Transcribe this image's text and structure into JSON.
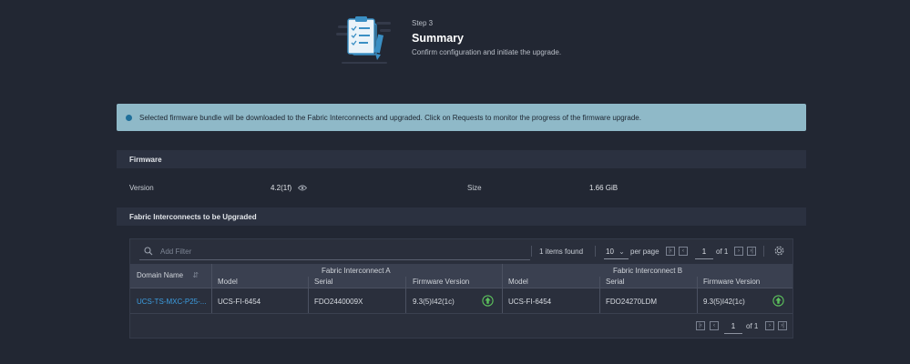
{
  "step": {
    "label": "Step 3",
    "title": "Summary",
    "description": "Confirm configuration and initiate the upgrade."
  },
  "banner": {
    "text": "Selected firmware bundle will be downloaded to the Fabric Interconnects and upgraded. Click on Requests to monitor the progress of the firmware upgrade."
  },
  "firmware": {
    "heading": "Firmware",
    "version_label": "Version",
    "version_value": "4.2(1f)",
    "size_label": "Size",
    "size_value": "1.66 GiB"
  },
  "fabric": {
    "heading": "Fabric Interconnects to be Upgraded"
  },
  "toolbar": {
    "filter_placeholder": "Add Filter",
    "items_found": "1 items found",
    "per_page_value": "10",
    "per_page_label": "per page",
    "page": "1",
    "of_pages": "of 1"
  },
  "table": {
    "domain_header": "Domain Name",
    "group_a": "Fabric Interconnect A",
    "group_b": "Fabric Interconnect B",
    "sub_headers": {
      "model": "Model",
      "serial": "Serial",
      "firmware_version": "Firmware Version"
    },
    "rows": [
      {
        "domain": "UCS-TS-MXC-P25-...",
        "a_model": "UCS-FI-6454",
        "a_serial": "FDO2440009X",
        "a_firmware": "9.3(5)I42(1c)",
        "b_model": "UCS-FI-6454",
        "b_serial": "FDO24270LDM",
        "b_firmware": "9.3(5)I42(1c)"
      }
    ]
  },
  "bottom_pager": {
    "page": "1",
    "of_pages": "of 1"
  },
  "colors": {
    "background": "#222733",
    "banner": "#8fb9c8",
    "link": "#3c9de0",
    "upgrade_icon": "#5cc15c"
  }
}
